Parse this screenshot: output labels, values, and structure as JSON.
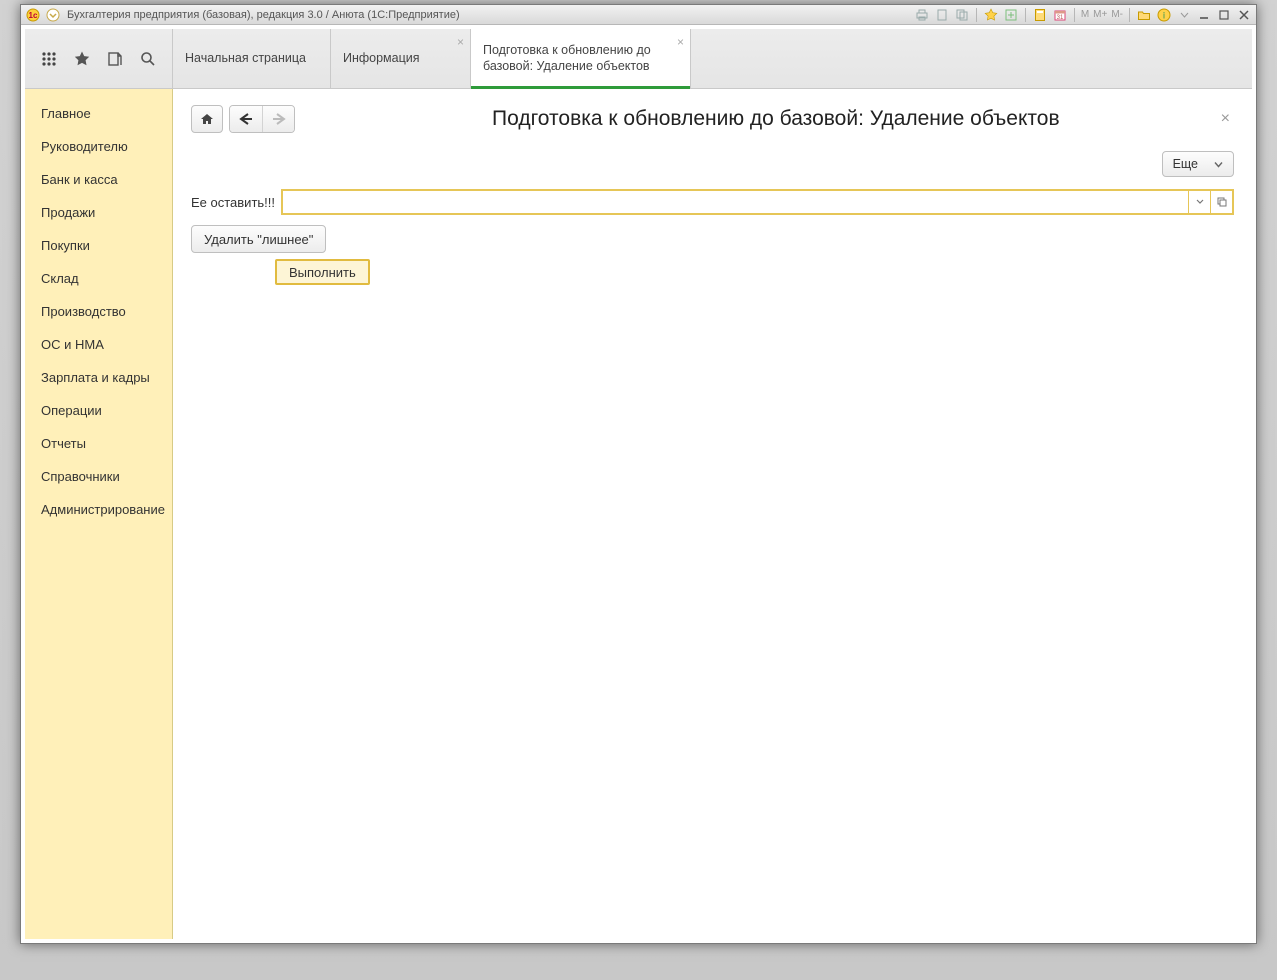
{
  "window": {
    "title": "Бухгалтерия предприятия (базовая), редакция 3.0 / Анюта  (1С:Предприятие)",
    "memory_labels": {
      "m": "M",
      "mplus": "M+",
      "mminus": "M-"
    }
  },
  "tabs": [
    {
      "label": "Начальная страница",
      "closable": false
    },
    {
      "label": "Информация",
      "closable": true
    },
    {
      "label": "Подготовка к обновлению до базовой: Удаление объектов",
      "closable": true,
      "active": true
    }
  ],
  "sidebar": {
    "items": [
      {
        "label": "Главное"
      },
      {
        "label": "Руководителю"
      },
      {
        "label": "Банк и касса"
      },
      {
        "label": "Продажи"
      },
      {
        "label": "Покупки"
      },
      {
        "label": "Склад"
      },
      {
        "label": "Производство"
      },
      {
        "label": "ОС и НМА"
      },
      {
        "label": "Зарплата и кадры"
      },
      {
        "label": "Операции"
      },
      {
        "label": "Отчеты"
      },
      {
        "label": "Справочники"
      },
      {
        "label": "Администрирование"
      }
    ]
  },
  "page": {
    "title": "Подготовка к обновлению до базовой: Удаление объектов",
    "more_label": "Еще",
    "field_label": "Ее оставить!!!",
    "input_value": "",
    "delete_button": "Удалить \"лишнее\"",
    "execute_button": "Выполнить"
  }
}
